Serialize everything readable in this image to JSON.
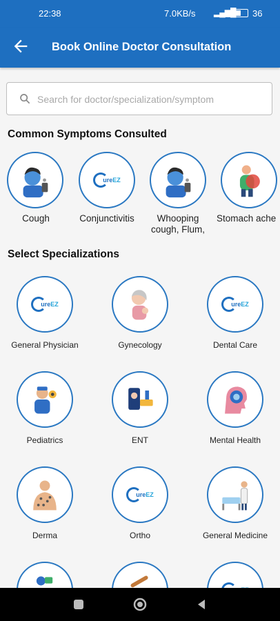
{
  "status": {
    "time": "22:38",
    "net": "7.0KB/s",
    "battery": "36"
  },
  "appbar": {
    "title": "Book Online Doctor Consultation",
    "back_icon": "back-arrow-icon"
  },
  "search": {
    "placeholder": "Search for doctor/specialization/symptom",
    "value": ""
  },
  "symptoms": {
    "title": "Common Symptoms Consulted",
    "items": [
      {
        "label": "Cough",
        "icon": "cough-icon"
      },
      {
        "label": "Conjunctivitis",
        "icon": "cureez-logo-icon"
      },
      {
        "label": "Whooping cough, Flum,",
        "icon": "cough-icon"
      },
      {
        "label": "Stomach ache",
        "icon": "stomach-ache-icon"
      }
    ]
  },
  "specializations": {
    "title": "Select Specializations",
    "items": [
      {
        "label": "General Physician",
        "icon": "cureez-logo-icon"
      },
      {
        "label": "Gynecology",
        "icon": "gynecology-icon"
      },
      {
        "label": "Dental Care",
        "icon": "cureez-logo-icon"
      },
      {
        "label": "Pediatrics",
        "icon": "pediatrics-icon"
      },
      {
        "label": "ENT",
        "icon": "ent-icon"
      },
      {
        "label": "Mental Health",
        "icon": "mental-health-icon"
      },
      {
        "label": "Derma",
        "icon": "derma-icon"
      },
      {
        "label": "Ortho",
        "icon": "cureez-logo-icon"
      },
      {
        "label": "General Medicine",
        "icon": "general-medicine-icon"
      }
    ]
  },
  "logo": {
    "prefix": "C",
    "cure": "ure",
    "ez": "EZ"
  },
  "colors": {
    "primary": "#1e6fc0",
    "circle_border": "#2a78c2"
  }
}
